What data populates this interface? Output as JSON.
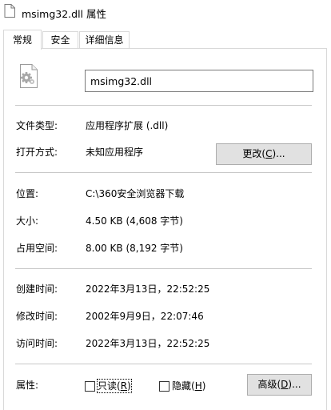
{
  "window": {
    "title": "msimg32.dll 属性"
  },
  "tabs": [
    {
      "label": "常规",
      "active": true
    },
    {
      "label": "安全",
      "active": false
    },
    {
      "label": "详细信息",
      "active": false
    }
  ],
  "file": {
    "icon": "gear-file-icon",
    "name": "msimg32.dll"
  },
  "properties": {
    "type_label": "文件类型:",
    "type_value": "应用程序扩展 (.dll)",
    "opens_with_label": "打开方式:",
    "opens_with_value": "未知应用程序",
    "change_button": {
      "text": "更改(",
      "accel": "C",
      "suffix": ")..."
    },
    "location_label": "位置:",
    "location_value": "C:\\360安全浏览器下载",
    "size_label": "大小:",
    "size_value": "4.50 KB (4,608 字节)",
    "size_on_disk_label": "占用空间:",
    "size_on_disk_value": "8.00 KB (8,192 字节)",
    "created_label": "创建时间:",
    "created_value": "2022年3月13日，22:52:25",
    "modified_label": "修改时间:",
    "modified_value": "2002年9月9日，22:07:46",
    "accessed_label": "访问时间:",
    "accessed_value": "2022年3月13日，22:52:25",
    "attributes_label": "属性:",
    "readonly": {
      "text": "只读(",
      "accel": "R",
      "suffix": ")",
      "checked": false
    },
    "hidden": {
      "text": "隐藏(",
      "accel": "H",
      "suffix": ")",
      "checked": false
    },
    "advanced_button": {
      "text": "高级(",
      "accel": "D",
      "suffix": ")..."
    }
  }
}
